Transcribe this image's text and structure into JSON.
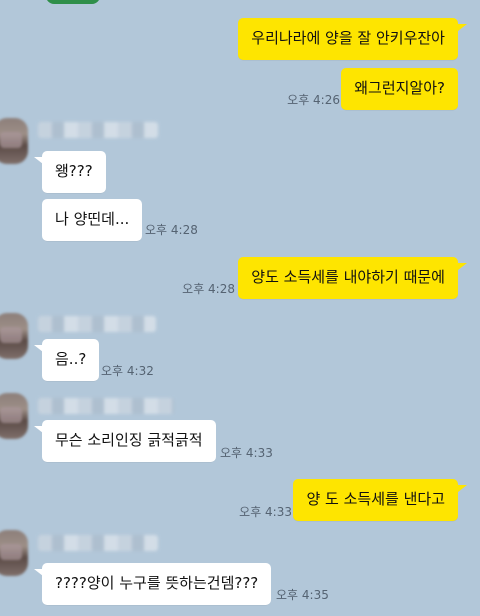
{
  "messages": [
    {
      "dir": "out",
      "text": "우리나라에 양을 잘 안키우잔아",
      "time": ""
    },
    {
      "dir": "out",
      "text": "왜그런지알아?",
      "time": "오후 4:26"
    },
    {
      "dir": "in",
      "text": "왱???",
      "time": ""
    },
    {
      "dir": "in",
      "text": "나 양띤데...",
      "time": "오후 4:28"
    },
    {
      "dir": "out",
      "text": "양도 소득세를 내야하기 때문에",
      "time": "오후 4:28"
    },
    {
      "dir": "in",
      "text": "음..?",
      "time": "오후 4:32"
    },
    {
      "dir": "in",
      "text": "무슨 소리인징 긁적긁적",
      "time": "오후 4:33"
    },
    {
      "dir": "out",
      "text": "양 도 소득세를 낸다고",
      "time": "오후 4:33"
    },
    {
      "dir": "in",
      "text": "????양이 누구를 뜻하는건뎀???",
      "time": "오후 4:35"
    }
  ],
  "colors": {
    "background": "#b2c7d9",
    "outgoing_bubble": "#fee500",
    "incoming_bubble": "#ffffff",
    "timestamp": "#556372"
  }
}
